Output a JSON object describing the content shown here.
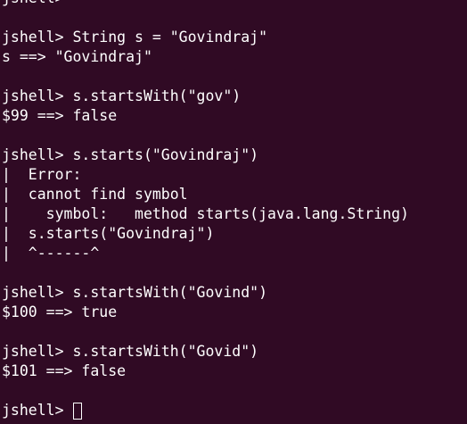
{
  "terminal": {
    "lines": [
      "jshell>",
      "",
      "jshell> String s = \"Govindraj\"",
      "s ==> \"Govindraj\"",
      "",
      "jshell> s.startsWith(\"gov\")",
      "$99 ==> false",
      "",
      "jshell> s.starts(\"Govindraj\")",
      "|  Error:",
      "|  cannot find symbol",
      "|    symbol:   method starts(java.lang.String)",
      "|  s.starts(\"Govindraj\")",
      "|  ^------^",
      "",
      "jshell> s.startsWith(\"Govind\")",
      "$100 ==> true",
      "",
      "jshell> s.startsWith(\"Govid\")",
      "$101 ==> false",
      ""
    ],
    "prompt": "jshell> ",
    "colors": {
      "background": "#300a24",
      "foreground": "#ffffff"
    }
  }
}
